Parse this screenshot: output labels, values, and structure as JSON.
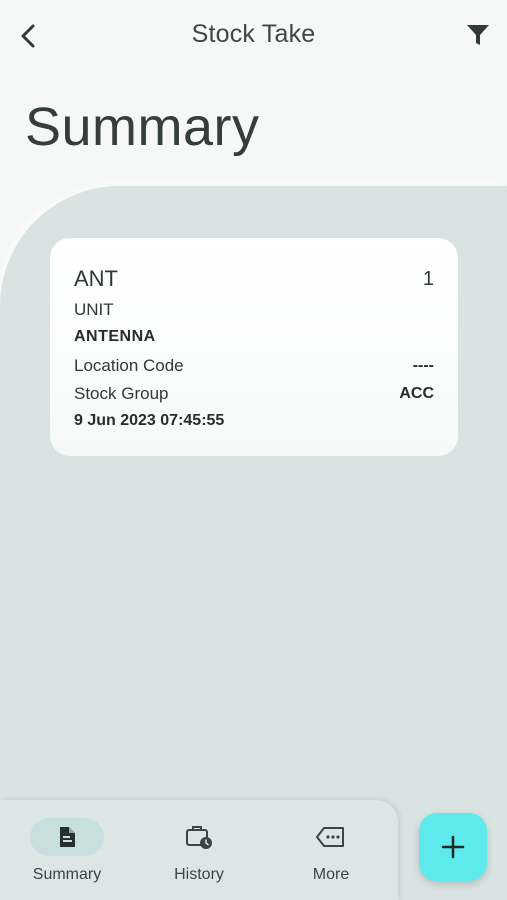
{
  "header": {
    "title": "Stock Take",
    "back_icon": "chevron-left-icon",
    "filter_icon": "filter-icon"
  },
  "page": {
    "title": "Summary"
  },
  "items": [
    {
      "code": "ANT",
      "quantity": "1",
      "unit": "UNIT",
      "description": "ANTENNA",
      "location_label": "Location Code",
      "location_value": "----",
      "stock_group_label": "Stock Group",
      "stock_group_value": "ACC",
      "timestamp": "9 Jun 2023 07:45:55"
    }
  ],
  "bottom_nav": {
    "items": [
      {
        "label": "Summary",
        "icon": "document-icon",
        "active": true
      },
      {
        "label": "History",
        "icon": "briefcase-clock-icon",
        "active": false
      },
      {
        "label": "More",
        "icon": "more-tag-icon",
        "active": false
      }
    ]
  },
  "fab": {
    "icon": "plus-icon"
  },
  "colors": {
    "panel_bg": "#d9e4e2",
    "fab_bg": "#5ee9ec",
    "active_pill": "#c7e0df"
  }
}
